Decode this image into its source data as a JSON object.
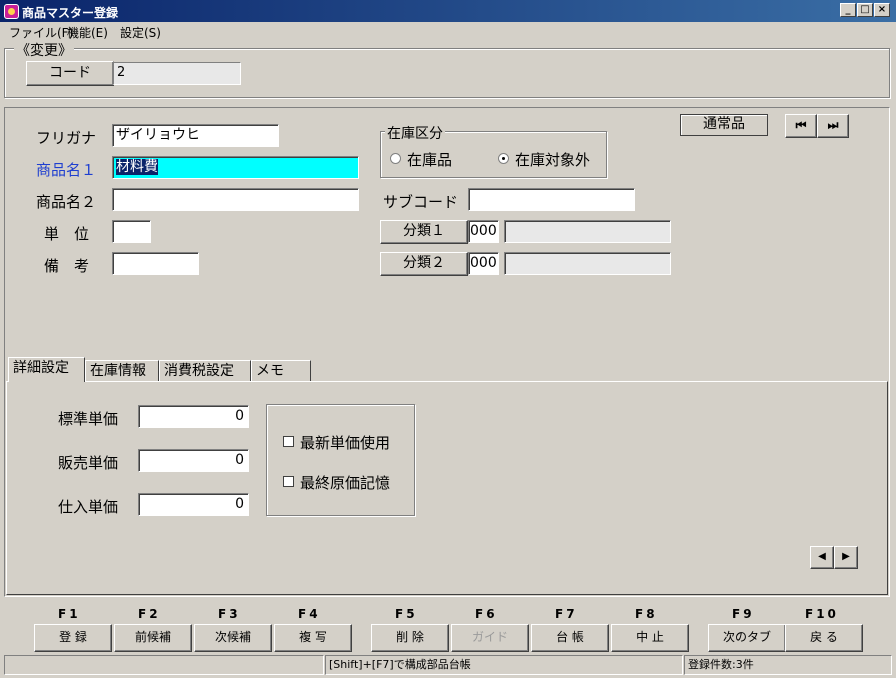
{
  "window": {
    "title": "商品マスター登録",
    "buttons": [
      "_",
      "□",
      "×"
    ]
  },
  "menu": [
    "ファイル(F)",
    "機能(E)",
    "設定(S)"
  ],
  "header_group": {
    "legend": "《変更》",
    "code_button": "コード",
    "code_value": "2"
  },
  "form": {
    "furigana_label": "フリガナ",
    "furigana_value": "ザイリョウヒ",
    "name1_label": "商品名１",
    "name1_value": "材料費",
    "name2_label": "商品名２",
    "name2_value": "",
    "unit_label": "単　位",
    "unit_value": "",
    "note_label": "備　考",
    "note_value": "",
    "stock_group_legend": "在庫区分",
    "stock_options": [
      {
        "label": "在庫品",
        "selected": false
      },
      {
        "label": "在庫対象外",
        "selected": true
      }
    ],
    "subcode_label": "サブコード",
    "subcode_value": "",
    "class1_button": "分類１",
    "class1_code": "000",
    "class1_name": "",
    "class2_button": "分類２",
    "class2_code": "000",
    "class2_name": "",
    "product_type_button": "通常品",
    "nav_first": "⏮",
    "nav_last": "⏭"
  },
  "tabs": [
    "詳細設定",
    "在庫情報",
    "消費税設定",
    "メモ"
  ],
  "detail": {
    "standard_price_label": "標準単価",
    "standard_price": "0",
    "sales_price_label": "販売単価",
    "sales_price": "0",
    "purchase_price_label": "仕入単価",
    "purchase_price": "0",
    "checkbox_latest": "最新単価使用",
    "checkbox_final": "最終原価記憶",
    "scroll_left": "◀",
    "scroll_right": "▶"
  },
  "fkeys": [
    {
      "key": "F1",
      "label": "登 録"
    },
    {
      "key": "F2",
      "label": "前候補"
    },
    {
      "key": "F3",
      "label": "次候補"
    },
    {
      "key": "F4",
      "label": "複 写"
    },
    {
      "key": "F5",
      "label": "削 除"
    },
    {
      "key": "F6",
      "label": "ガイド"
    },
    {
      "key": "F7",
      "label": "台 帳"
    },
    {
      "key": "F8",
      "label": "中 止"
    },
    {
      "key": "F9",
      "label": "次のタブ"
    },
    {
      "key": "F10",
      "label": "戻 る"
    }
  ],
  "status": {
    "hint": "[Shift]+[F7]で構成部品台帳",
    "count": "登録件数:3件"
  }
}
